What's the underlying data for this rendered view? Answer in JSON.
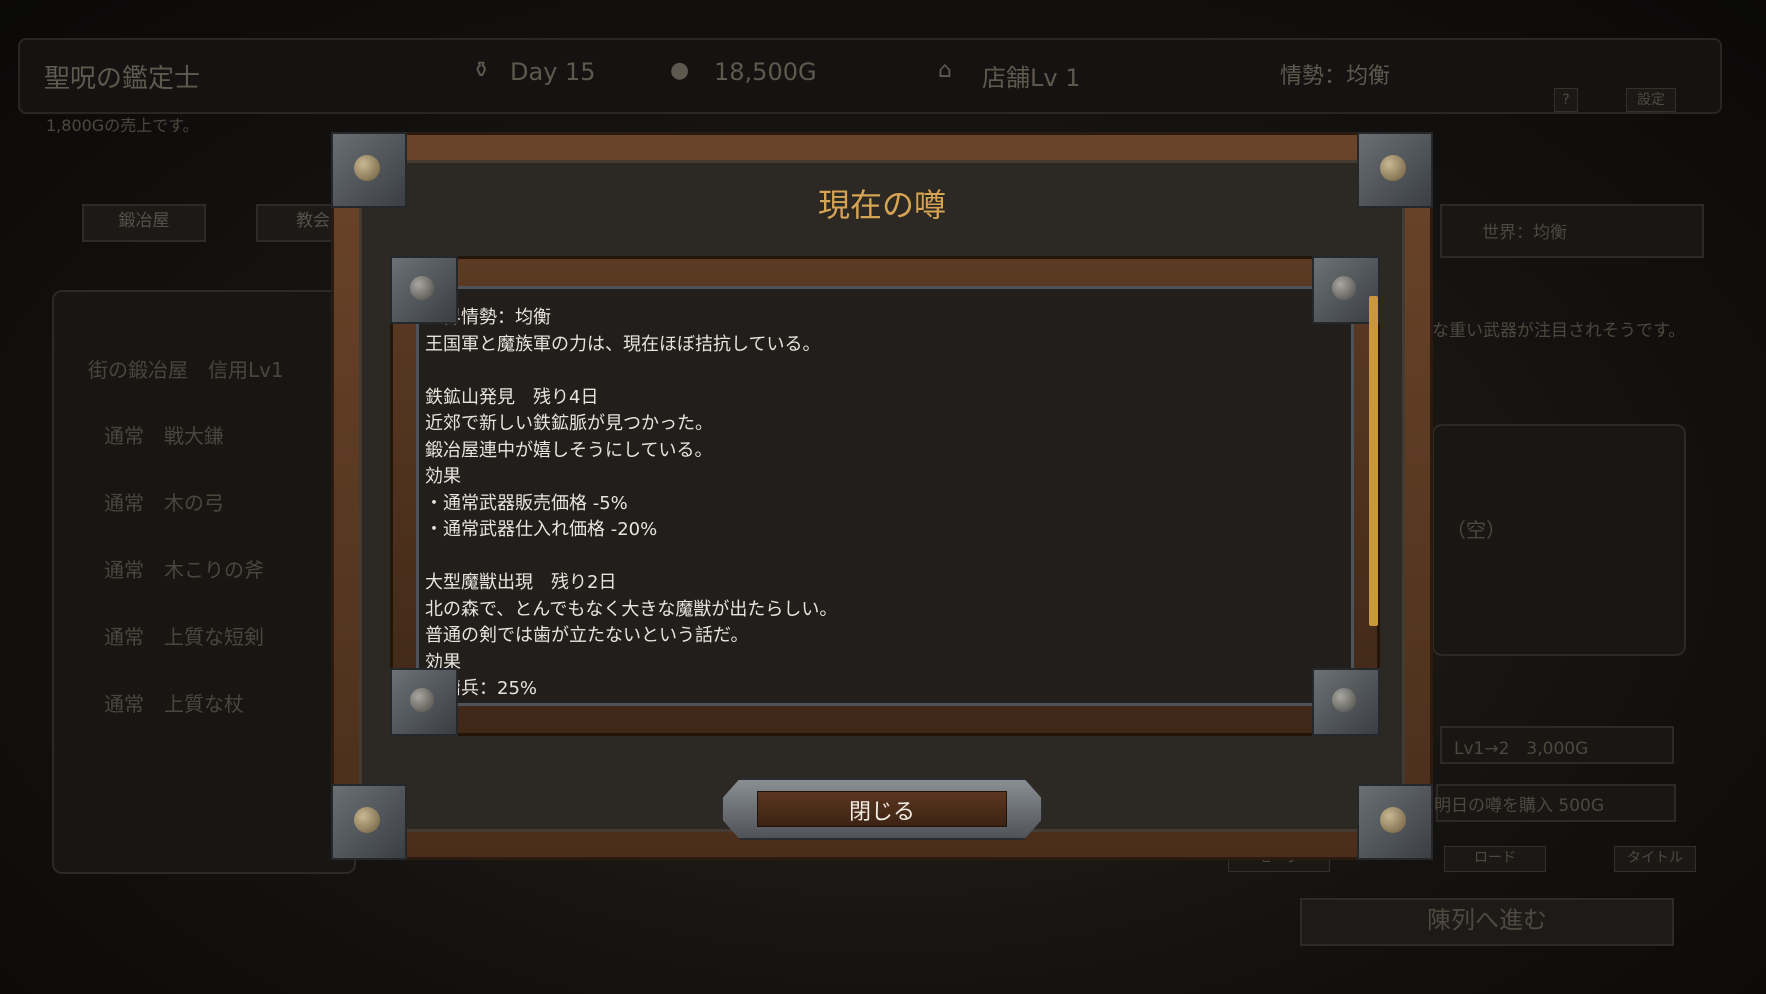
{
  "header": {
    "game_title": "聖呪の鑑定士",
    "day": "Day 15",
    "gold": "18,500G",
    "shop_level": "店舗Lv 1",
    "situation": "情勢：均衡",
    "help_label": "?",
    "settings_label": "設定",
    "icons": [
      "scroll-icon",
      "coin-icon",
      "shop-icon"
    ]
  },
  "status_message": "1,800Gの売上です。",
  "tabs": [
    "鍛冶屋",
    "教会"
  ],
  "left_panel": {
    "shop_name": "街の鍛冶屋",
    "trust": "信用Lv1",
    "items": [
      "通常　戦大鎌",
      "通常　木の弓",
      "通常　木こりの斧",
      "通常　上質な短剣",
      "通常　上質な杖"
    ]
  },
  "right_panel": {
    "world": "世界：均衡",
    "hint": "な重い武器が注目されそうです。",
    "empty": "（空）",
    "upgrade": "Lv1→2　3,000G",
    "buy_rumor": "明日の噂を購入 500G",
    "save": "セーブ",
    "load": "ロード",
    "title": "タイトル",
    "advance": "陳列へ進む"
  },
  "modal": {
    "title": "現在の噂",
    "lines": [
      "世界情勢：均衡",
      "王国軍と魔族軍の力は、現在ほぼ拮抗している。",
      "",
      "鉄鉱山発見　残り4日",
      "近郊で新しい鉄鉱脈が見つかった。",
      "鍛冶屋連中が嬉しそうにしている。",
      "効果",
      "・通常武器販売価格 -5%",
      "・通常武器仕入れ価格 -20%",
      "",
      "大型魔獣出現　残り2日",
      "北の森で、とんでもなく大きな魔獣が出たらしい。",
      "普通の剣では歯が立たないという話だ。",
      "効果",
      "・傭兵：25%"
    ],
    "close_label": "閉じる",
    "accent": "#d6a354"
  }
}
